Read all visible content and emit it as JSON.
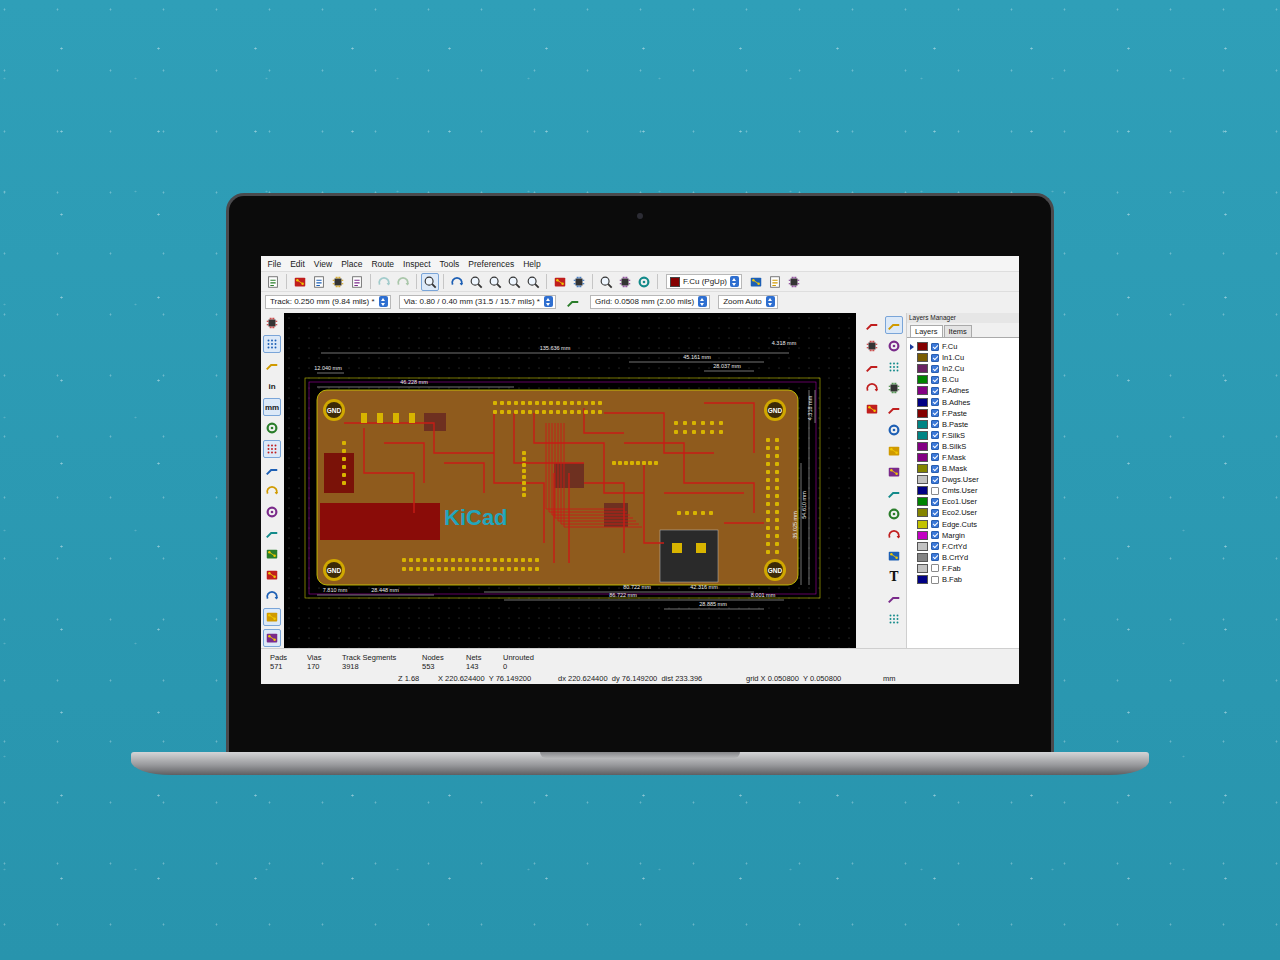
{
  "menu": [
    "File",
    "Edit",
    "View",
    "Place",
    "Route",
    "Inspect",
    "Tools",
    "Preferences",
    "Help"
  ],
  "main_toolbar": {
    "buttons": [
      {
        "disabled": false,
        "selected": false
      },
      {
        "disabled": false,
        "selected": false
      },
      {
        "disabled": false,
        "selected": false
      },
      {
        "disabled": false,
        "selected": false
      },
      {
        "disabled": false,
        "selected": false
      },
      {
        "disabled": true,
        "selected": false
      },
      {
        "disabled": true,
        "selected": false
      },
      {
        "disabled": false,
        "selected": true
      },
      {
        "disabled": false,
        "selected": false
      },
      {
        "disabled": false,
        "selected": false
      },
      {
        "disabled": false,
        "selected": false
      },
      {
        "disabled": false,
        "selected": false
      },
      {
        "disabled": false,
        "selected": false
      },
      {
        "disabled": false,
        "selected": false
      },
      {
        "disabled": false,
        "selected": false
      },
      {
        "disabled": false,
        "selected": false
      },
      {
        "disabled": false,
        "selected": false
      },
      {
        "disabled": false,
        "selected": false
      }
    ],
    "layer": "F.Cu (PgUp)",
    "buttons_after": [
      {
        "disabled": false,
        "selected": false
      },
      {
        "disabled": false,
        "selected": false
      },
      {
        "disabled": false,
        "selected": false
      }
    ]
  },
  "options_bar": {
    "track": "Track: 0.250 mm (9.84 mils) *",
    "via": "Via: 0.80 / 0.40 mm (31.5 / 15.7 mils) *",
    "grid": "Grid: 0.0508 mm (2.00 mils)",
    "zoom": "Zoom Auto"
  },
  "left_toolbar": [
    {
      "kind": "icon",
      "selected": false
    },
    {
      "kind": "icon",
      "selected": true
    },
    {
      "kind": "icon",
      "selected": false
    },
    {
      "kind": "text",
      "label": "in",
      "selected": false
    },
    {
      "kind": "text",
      "label": "mm",
      "selected": true
    },
    {
      "kind": "icon",
      "selected": false
    },
    {
      "kind": "icon",
      "selected": true
    },
    {
      "kind": "icon",
      "selected": false
    },
    {
      "kind": "icon",
      "selected": false
    },
    {
      "kind": "icon",
      "selected": false
    },
    {
      "kind": "icon",
      "selected": false
    },
    {
      "kind": "icon",
      "selected": false
    },
    {
      "kind": "icon",
      "selected": false
    },
    {
      "kind": "icon",
      "selected": false
    },
    {
      "kind": "icon",
      "selected": true
    },
    {
      "kind": "icon",
      "selected": true
    }
  ],
  "right_toolbar": {
    "column_a": [
      {
        "kind": "icon",
        "selected": false
      },
      {
        "kind": "icon",
        "selected": false
      },
      {
        "kind": "icon",
        "selected": false
      },
      {
        "kind": "icon",
        "selected": false
      },
      {
        "kind": "icon",
        "selected": false
      }
    ],
    "column_b": [
      {
        "kind": "icon",
        "selected": true
      },
      {
        "kind": "icon",
        "selected": false
      },
      {
        "kind": "icon",
        "selected": false
      },
      {
        "kind": "icon",
        "selected": false
      },
      {
        "kind": "icon",
        "selected": false
      },
      {
        "kind": "icon",
        "selected": false
      },
      {
        "kind": "icon",
        "selected": false
      },
      {
        "kind": "icon",
        "selected": false
      },
      {
        "kind": "icon",
        "selected": false
      },
      {
        "kind": "icon",
        "selected": false
      },
      {
        "kind": "icon",
        "selected": false
      },
      {
        "kind": "icon",
        "selected": false
      },
      {
        "kind": "text",
        "label": "T",
        "selected": false
      },
      {
        "kind": "icon",
        "selected": false
      },
      {
        "kind": "icon",
        "selected": false
      }
    ]
  },
  "board": {
    "logo": "KiCad",
    "holes": [
      "GND",
      "GND",
      "GND",
      "GND"
    ],
    "dimensions": [
      "135.636 mm",
      "45.161 mm",
      "28.037 mm",
      "4.318 mm",
      "12.040 mm",
      "46.228 mm",
      "4.318 mm",
      "54.610 mm",
      "35.025 mm",
      "7.810 mm",
      "28.448 mm",
      "80.722 mm",
      "86.722 mm",
      "42.316 mm",
      "8.001 mm",
      "28.885 mm"
    ]
  },
  "layers_manager": {
    "title": "Layers Manager",
    "tabs": [
      {
        "label": "Layers",
        "selected": true
      },
      {
        "label": "Items",
        "selected": false
      }
    ],
    "layers": [
      {
        "name": "F.Cu",
        "visible": true,
        "active": true,
        "color": "#840000"
      },
      {
        "name": "In1.Cu",
        "visible": true,
        "active": false,
        "color": "#7a5c00"
      },
      {
        "name": "In2.Cu",
        "visible": true,
        "active": false,
        "color": "#6a2262"
      },
      {
        "name": "B.Cu",
        "visible": true,
        "active": false,
        "color": "#008400"
      },
      {
        "name": "F.Adhes",
        "visible": true,
        "active": false,
        "color": "#840084"
      },
      {
        "name": "B.Adhes",
        "visible": true,
        "active": false,
        "color": "#000084"
      },
      {
        "name": "F.Paste",
        "visible": true,
        "active": false,
        "color": "#840000"
      },
      {
        "name": "B.Paste",
        "visible": true,
        "active": false,
        "color": "#008484"
      },
      {
        "name": "F.SilkS",
        "visible": true,
        "active": false,
        "color": "#008484"
      },
      {
        "name": "B.SilkS",
        "visible": true,
        "active": false,
        "color": "#840084"
      },
      {
        "name": "F.Mask",
        "visible": true,
        "active": false,
        "color": "#840084"
      },
      {
        "name": "B.Mask",
        "visible": true,
        "active": false,
        "color": "#848400"
      },
      {
        "name": "Dwgs.User",
        "visible": true,
        "active": false,
        "color": "#c2c2c2"
      },
      {
        "name": "Cmts.User",
        "visible": false,
        "active": false,
        "color": "#000084"
      },
      {
        "name": "Eco1.User",
        "visible": true,
        "active": false,
        "color": "#008400"
      },
      {
        "name": "Eco2.User",
        "visible": true,
        "active": false,
        "color": "#848400"
      },
      {
        "name": "Edge.Cuts",
        "visible": true,
        "active": false,
        "color": "#c2c200"
      },
      {
        "name": "Margin",
        "visible": true,
        "active": false,
        "color": "#c200c2"
      },
      {
        "name": "F.CrtYd",
        "visible": true,
        "active": false,
        "color": "#c2c2c2"
      },
      {
        "name": "B.CrtYd",
        "visible": true,
        "active": false,
        "color": "#848484"
      },
      {
        "name": "F.Fab",
        "visible": false,
        "active": false,
        "color": "#c2c2c2"
      },
      {
        "name": "B.Fab",
        "visible": false,
        "active": false,
        "color": "#000084"
      }
    ]
  },
  "status": {
    "counts": [
      {
        "label": "Pads",
        "value": "571"
      },
      {
        "label": "Vias",
        "value": "170"
      },
      {
        "label": "Track Segments",
        "value": "3918"
      },
      {
        "label": "Nodes",
        "value": "553"
      },
      {
        "label": "Nets",
        "value": "143"
      },
      {
        "label": "Unrouted",
        "value": "0"
      }
    ],
    "coords": [
      "Z 1.68",
      "X 220.624400  Y 76.149200",
      "dx 220.624400  dy 76.149200  dist 233.396",
      "grid X 0.050800  Y 0.050800",
      "mm"
    ]
  }
}
